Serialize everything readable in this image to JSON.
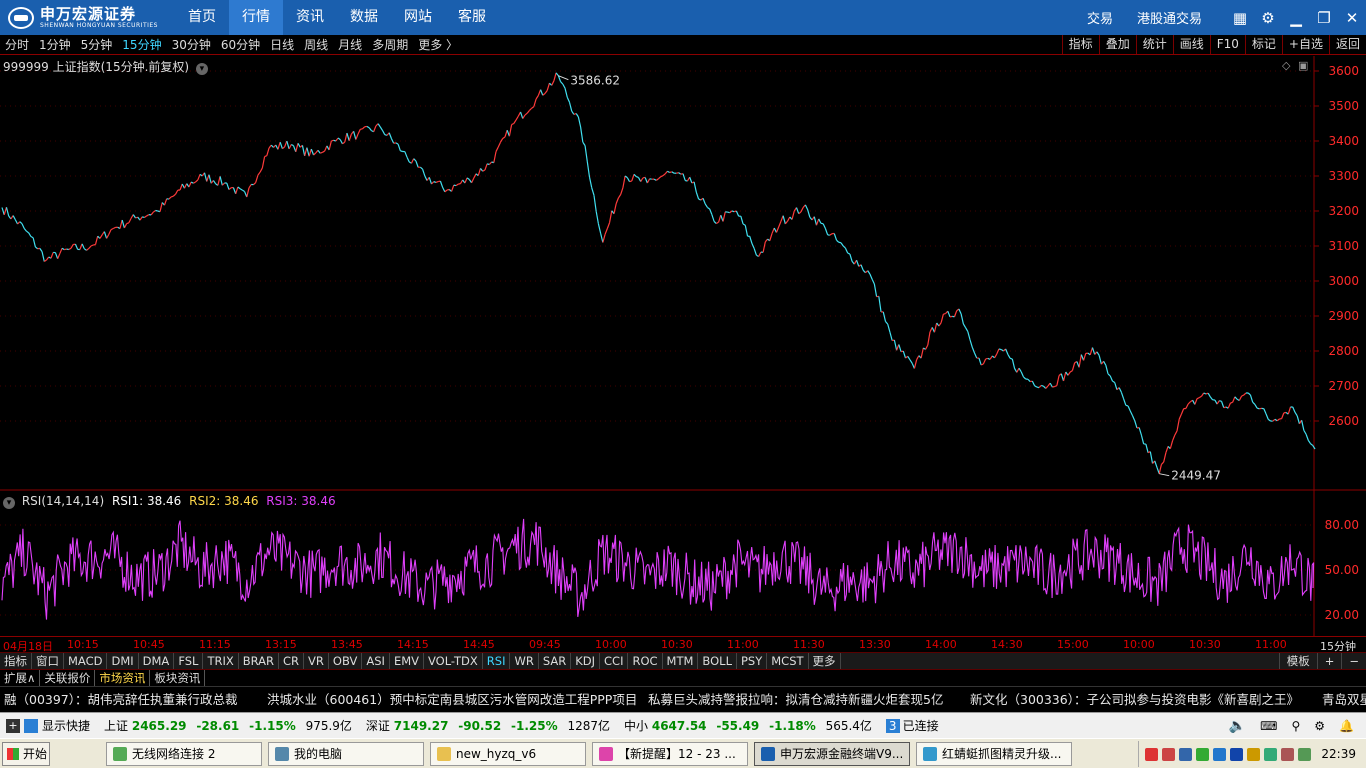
{
  "nav": {
    "logo_cn": "申万宏源证券",
    "logo_en": "SHENWAN HONGYUAN SECURITIES",
    "items": [
      "首页",
      "行情",
      "资讯",
      "数据",
      "网站",
      "客服"
    ],
    "active": 1,
    "right_links": [
      "交易",
      "港股通交易"
    ]
  },
  "periods": {
    "items": [
      "分时",
      "1分钟",
      "5分钟",
      "15分钟",
      "30分钟",
      "60分钟",
      "日线",
      "周线",
      "月线",
      "多周期",
      "更多 〉"
    ],
    "active": 3,
    "tools": [
      "指标",
      "叠加",
      "统计",
      "画线",
      "F10",
      "标记",
      "+自选",
      "返回"
    ]
  },
  "main_chart": {
    "label": "999999 上证指数(15分钟.前复权)",
    "high_label": "3586.62",
    "low_label": "2449.47",
    "y_ticks": [
      "3600",
      "3500",
      "3400",
      "3300",
      "3200",
      "3100",
      "3000",
      "2900",
      "2800",
      "2700",
      "2600"
    ]
  },
  "rsi": {
    "name": "RSI(14,14,14)",
    "rsi1": "RSI1: 38.46",
    "rsi2": "RSI2: 38.46",
    "rsi3": "RSI3: 38.46",
    "y_ticks": [
      "80.00",
      "50.00",
      "20.00"
    ]
  },
  "chart_data": {
    "type": "line",
    "title": "999999 上证指数(15分钟.前复权)",
    "ylim": [
      2420,
      3620
    ],
    "x": [
      "04月18日",
      "10:15",
      "10:45",
      "11:15",
      "13:15",
      "13:45",
      "14:15",
      "14:45",
      "09:45",
      "10:00",
      "10:30",
      "11:00",
      "11:30",
      "13:30",
      "14:00",
      "14:30",
      "15:00",
      "10:00",
      "10:30",
      "11:00"
    ],
    "series": [
      {
        "values": [
          3210,
          3150,
          3060,
          3090,
          3100,
          3150,
          3180,
          3200,
          3260,
          3300,
          3280,
          3240,
          3380,
          3390,
          3360,
          3400,
          3420,
          3440,
          3370,
          3300,
          3260,
          3290,
          3340,
          3450,
          3520,
          3586.62,
          3440,
          3110,
          3300,
          3280,
          3310,
          3280,
          3170,
          3200,
          3070,
          3170,
          3210,
          3150,
          3080,
          3020,
          2830,
          2750,
          2880,
          2920,
          2760,
          2800,
          2720,
          2700,
          2740,
          2810,
          2710,
          2580,
          2449.47,
          2620,
          2680,
          2640,
          2680,
          2600,
          2640,
          2520
        ]
      },
      {
        "name": "RSI1",
        "values": [
          40,
          62,
          33,
          55,
          58,
          60,
          45,
          48,
          66,
          50,
          59,
          43,
          63,
          55,
          47,
          56,
          52,
          60,
          47,
          38,
          44,
          51,
          56,
          66,
          70,
          48,
          32,
          62,
          55,
          45,
          54,
          42,
          38,
          55,
          48,
          60,
          50,
          35,
          43,
          41,
          56,
          48,
          60,
          64,
          49,
          52,
          55,
          46,
          54,
          62,
          57,
          45,
          40,
          68,
          55,
          42,
          63,
          38,
          58,
          38
        ]
      }
    ]
  },
  "time_axis": [
    "04月18日",
    "10:15",
    "10:45",
    "11:15",
    "13:15",
    "13:45",
    "14:15",
    "14:45",
    "09:45",
    "10:00",
    "10:30",
    "11:00",
    "11:30",
    "13:30",
    "14:00",
    "14:30",
    "15:00",
    "10:00",
    "10:30",
    "11:00"
  ],
  "time_axis_right": "15分钟",
  "indicators": {
    "items": [
      "指标",
      "窗口",
      "MACD",
      "DMI",
      "DMA",
      "FSL",
      "TRIX",
      "BRAR",
      "CR",
      "VR",
      "OBV",
      "ASI",
      "EMV",
      "VOL-TDX",
      "RSI",
      "WR",
      "SAR",
      "KDJ",
      "CCI",
      "ROC",
      "MTM",
      "BOLL",
      "PSY",
      "MCST",
      "更多"
    ],
    "active": 14,
    "right": [
      "模板",
      "+",
      "−"
    ]
  },
  "bottom_tabs": {
    "items": [
      "扩展∧",
      "关联报价",
      "市场资讯",
      "板块资讯"
    ],
    "active": 2
  },
  "news": [
    "融（00397）：胡伟亮辞任执董兼行政总裁",
    "洪城水业（600461）预中标定南县城区污水管网改造工程PPP项目",
    "私募巨头减持警报拉响：拟清仓减持新疆火炬套现5亿",
    "新文化（300336）：子公司拟参与投资电影《新喜剧之王》",
    "青岛双星"
  ],
  "status": {
    "shortcut": "显示快捷",
    "sh_name": "上证",
    "sh_val": "2465.29",
    "sh_chg": "-28.61",
    "sh_pct": "-1.15%",
    "sh_amt": "975.9亿",
    "sz_name": "深证",
    "sz_val": "7149.27",
    "sz_chg": "-90.52",
    "sz_pct": "-1.25%",
    "sz_amt": "1287亿",
    "zx_name": "中小",
    "zx_val": "4647.54",
    "zx_chg": "-55.49",
    "zx_pct": "-1.18%",
    "zx_amt": "565.4亿",
    "conn_count": "3",
    "conn": "已连接"
  },
  "taskbar": {
    "start": "开始",
    "tasks": [
      "无线网络连接 2",
      "我的电脑",
      "new_hyzq_v6",
      "【新提醒】12 - 23 ...",
      "申万宏源金融终端V9...",
      "红蜻蜓抓图精灵升级..."
    ],
    "active": 4,
    "clock": "22:39"
  },
  "colors": {
    "up": "#ff3b3b",
    "down": "#40e0f0",
    "rsi": "#e040fb",
    "grid": "#8b0000",
    "axis_text": "#ff2a2a"
  }
}
